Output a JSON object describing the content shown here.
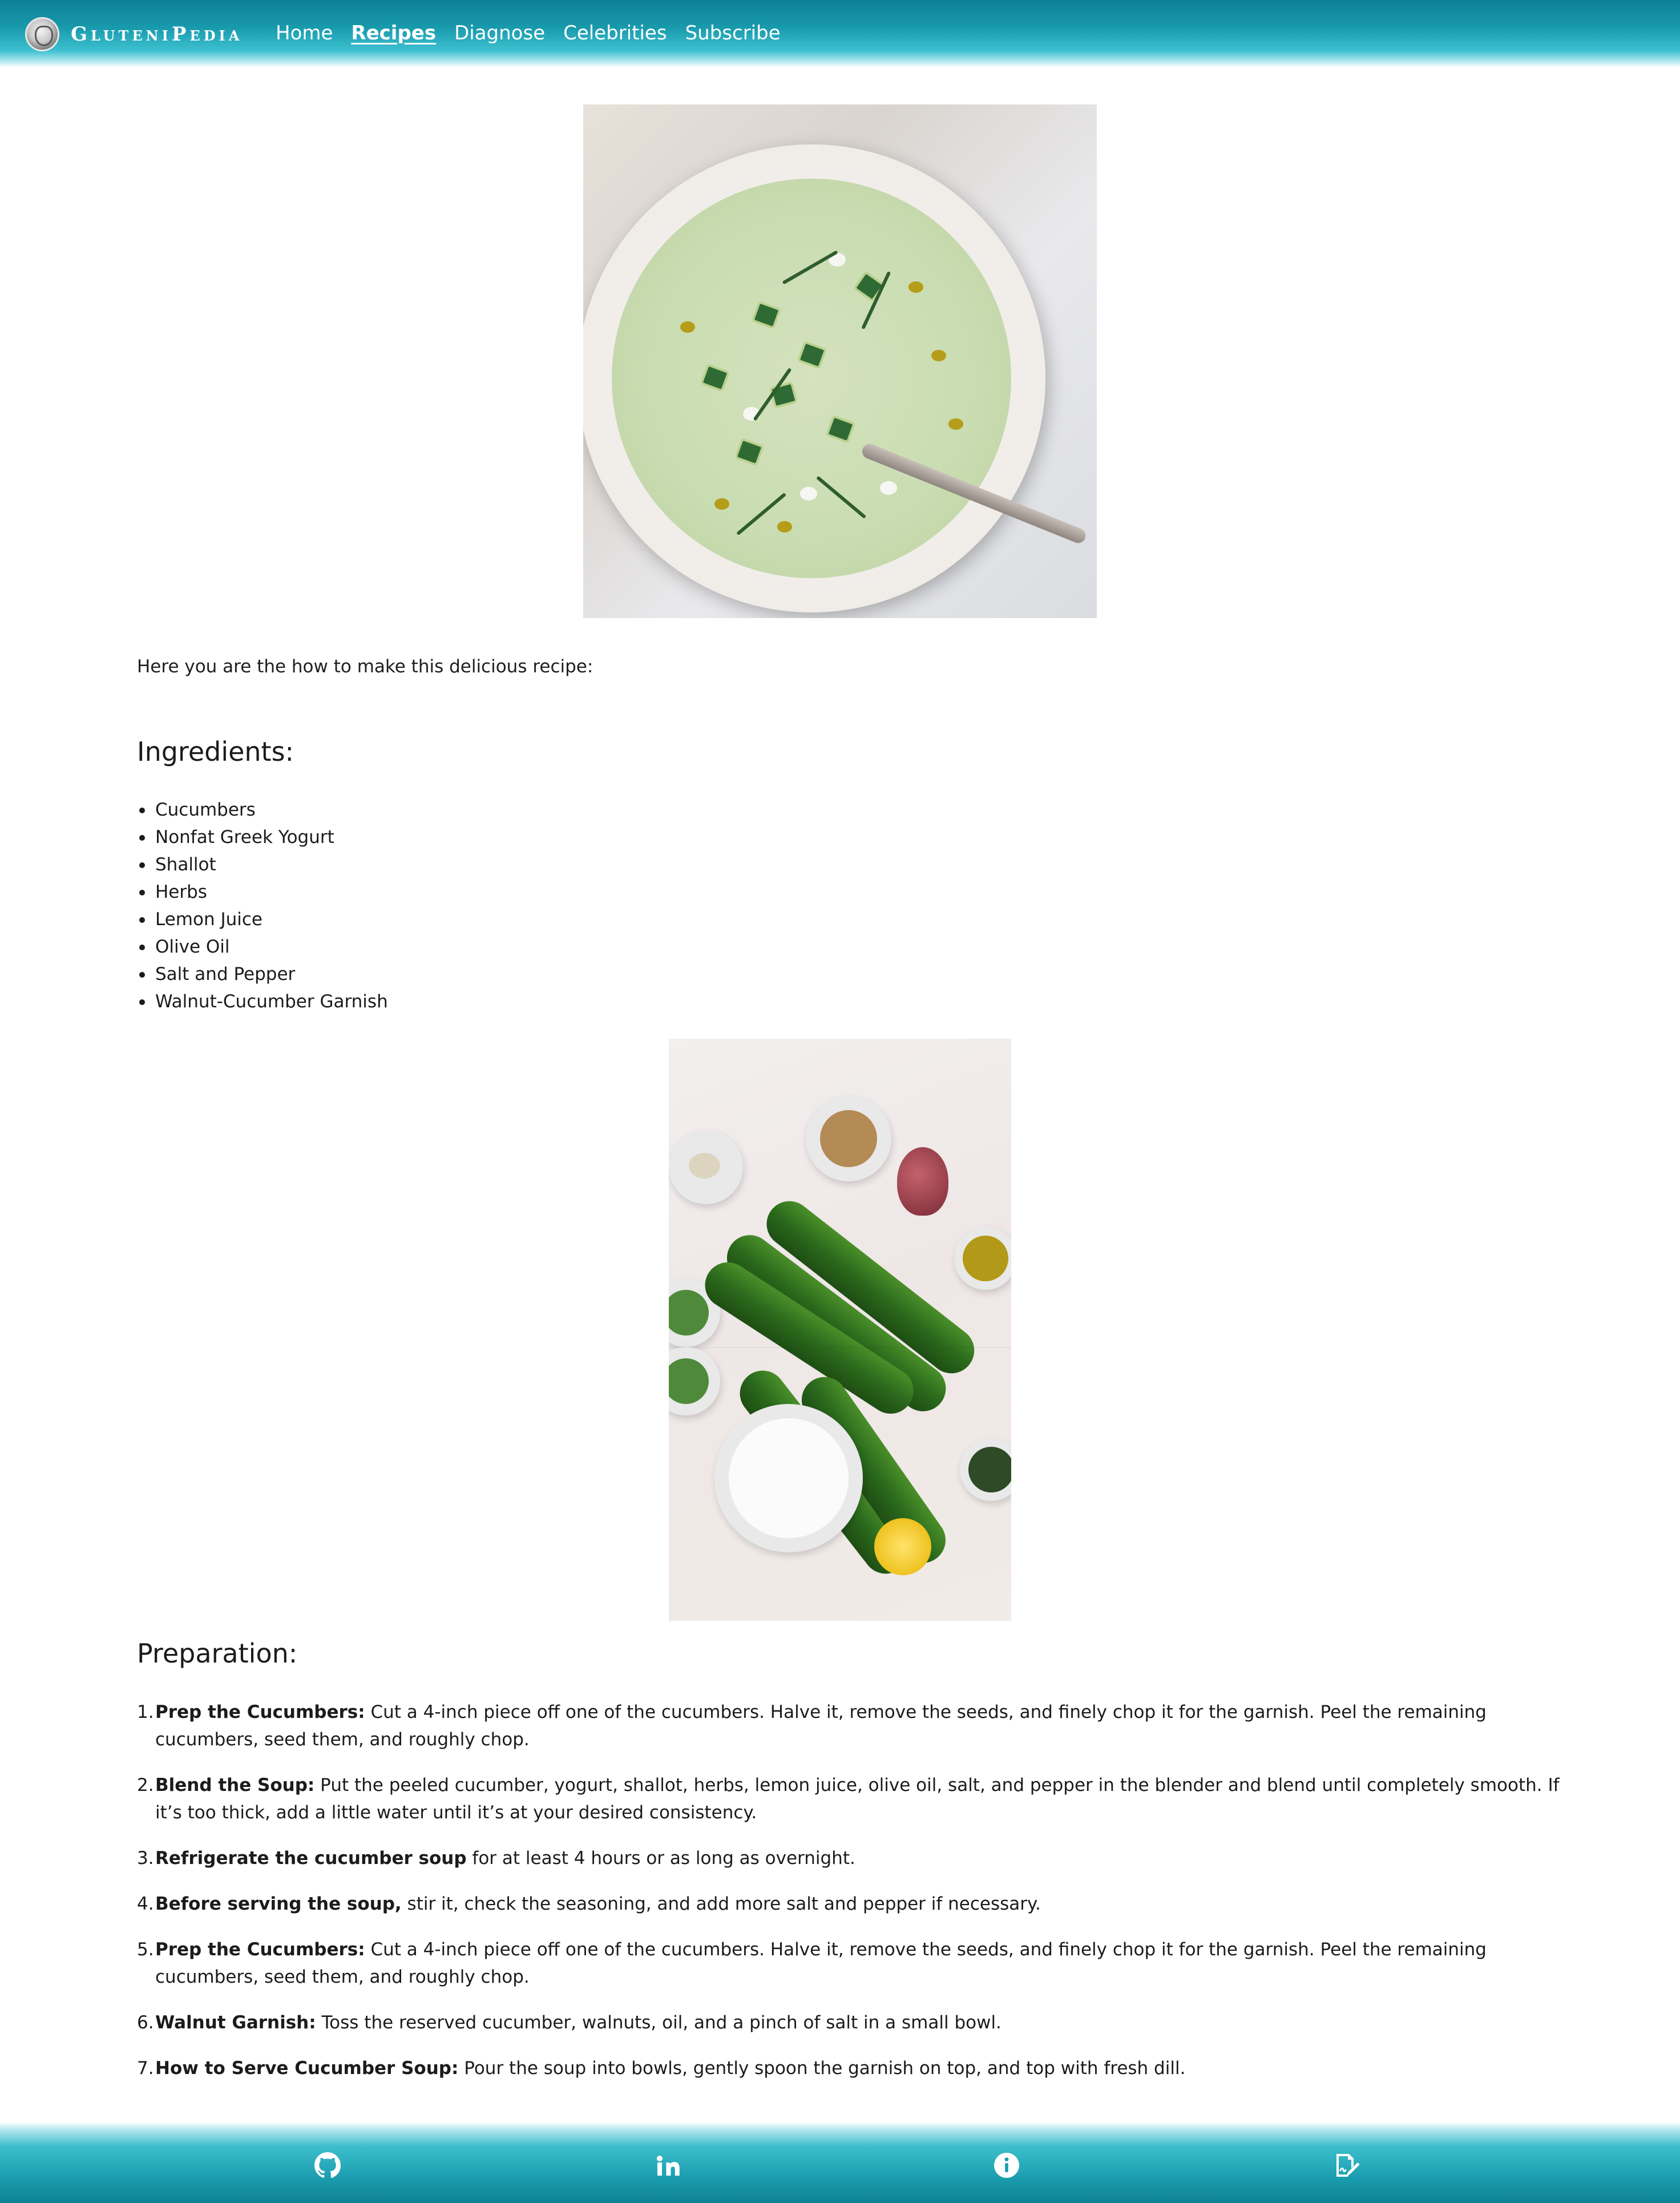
{
  "brand": {
    "name": "GluteniPedia"
  },
  "nav": {
    "items": [
      {
        "label": "Home",
        "active": false
      },
      {
        "label": "Recipes",
        "active": true
      },
      {
        "label": "Diagnose",
        "active": false
      },
      {
        "label": "Celebrities",
        "active": false
      },
      {
        "label": "Subscribe",
        "active": false
      }
    ]
  },
  "recipe": {
    "intro": "Here you are the how to make this delicious recipe:",
    "ingredients_heading": "Ingredients:",
    "ingredients": [
      "Cucumbers",
      "Nonfat Greek Yogurt",
      "Shallot",
      "Herbs",
      "Lemon Juice",
      "Olive Oil",
      "Salt and Pepper",
      "Walnut-Cucumber Garnish"
    ],
    "preparation_heading": "Preparation:",
    "steps": [
      {
        "num": "1.",
        "bold": "Prep the Cucumbers:",
        "text": " Cut a 4-inch piece off one of the cucumbers. Halve it, remove the seeds, and finely chop it for the garnish. Peel the remaining cucumbers, seed them, and roughly chop."
      },
      {
        "num": "2.",
        "bold": "Blend the Soup:",
        "text": " Put the peeled cucumber, yogurt, shallot, herbs, lemon juice, olive oil, salt, and pepper in the blender and blend until completely smooth. If it’s too thick, add a little water until it’s at your desired consistency."
      },
      {
        "num": "3.",
        "bold": "Refrigerate the cucumber soup",
        "text": " for at least 4 hours or as long as overnight."
      },
      {
        "num": "4.",
        "bold": "Before serving the soup,",
        "text": " stir it, check the seasoning, and add more salt and pepper if necessary."
      },
      {
        "num": "5.",
        "bold": "Prep the Cucumbers:",
        "text": " Cut a 4-inch piece off one of the cucumbers. Halve it, remove the seeds, and finely chop it for the garnish. Peel the remaining cucumbers, seed them, and roughly chop."
      },
      {
        "num": "6.",
        "bold": "Walnut Garnish:",
        "text": " Toss the reserved cucumber, walnuts, oil, and a pinch of salt in a small bowl."
      },
      {
        "num": "7.",
        "bold": "How to Serve Cucumber Soup:",
        "text": " Pour the soup into bowls, gently spoon the garnish on top, and top with fresh dill."
      }
    ]
  },
  "footer": {
    "icons": [
      "github-icon",
      "linkedin-icon",
      "info-icon",
      "signature-icon"
    ]
  },
  "colors": {
    "nav_dark": "#0f8096",
    "nav_light": "#3cc0cf",
    "text": "#1b1b1b"
  }
}
